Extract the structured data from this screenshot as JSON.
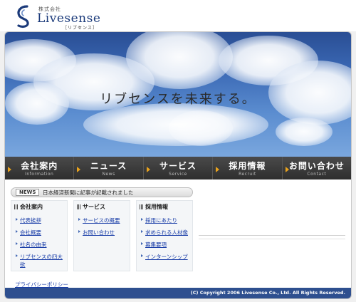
{
  "header": {
    "company_sub": "株式会社",
    "brand": "Livesense",
    "brand_kana": "［リブセンス］"
  },
  "hero": {
    "tagline": "リブセンスを未来する。"
  },
  "nav": {
    "items": [
      {
        "label": "会社案内",
        "sub": "Information"
      },
      {
        "label": "ニュース",
        "sub": "News"
      },
      {
        "label": "サービス",
        "sub": "Service"
      },
      {
        "label": "採用情報",
        "sub": "Recruit"
      },
      {
        "label": "お問い合わせ",
        "sub": "Contact"
      }
    ]
  },
  "news": {
    "badge": "NEWS",
    "text": "日本経済新聞に記事が記載されました"
  },
  "columns": [
    {
      "title": "会社案内",
      "links": [
        "代表挨拶",
        "会社概要",
        "社名の由来",
        "リブセンスの四大欲"
      ]
    },
    {
      "title": "サービス",
      "links": [
        "サービスの概要",
        "お問い合わせ"
      ]
    },
    {
      "title": "採用情報",
      "links": [
        "採用にあたり",
        "求められる人材像",
        "募集要項",
        "インターンシップ"
      ]
    }
  ],
  "footer": {
    "privacy": "プライバシーポリシー",
    "copyright": "(C) Copyright 2006 Livesense Co., Ltd. All Rights Reserved."
  },
  "colors": {
    "brand_blue": "#1b3a7a",
    "nav_bg": "#3c3c3c",
    "accent_orange": "#e8a21e",
    "link_blue": "#1a3ea8",
    "footer_bg": "#2e4f8f"
  }
}
